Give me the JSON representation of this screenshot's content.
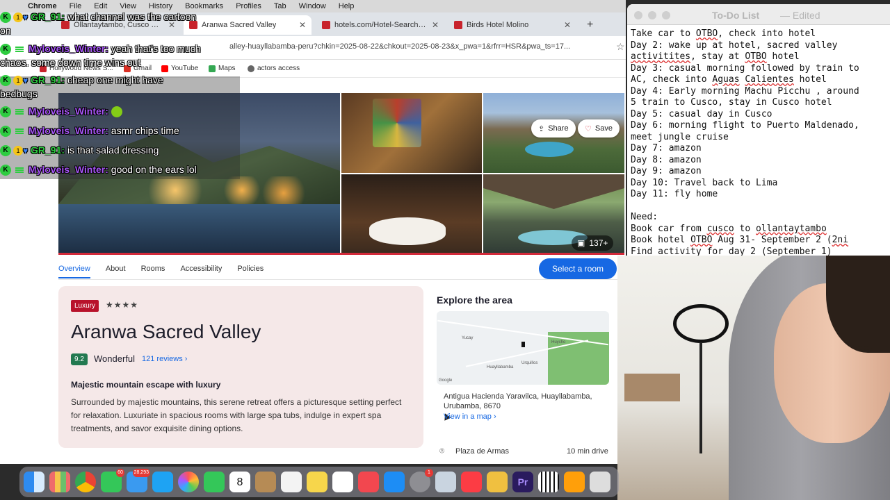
{
  "menubar": {
    "apple": "",
    "items": [
      "Chrome",
      "File",
      "Edit",
      "View",
      "History",
      "Bookmarks",
      "Profiles",
      "Tab",
      "Window",
      "Help"
    ]
  },
  "tabs": [
    {
      "label": "Ollantaytambo, Cusco Regio",
      "active": false
    },
    {
      "label": "Aranwa Sacred Valley",
      "active": true
    },
    {
      "label": "hotels.com/Hotel-Search?de",
      "active": false
    },
    {
      "label": "Birds Hotel Molino",
      "active": false
    }
  ],
  "new_tab": "+",
  "url": "alley-huayllabamba-peru?chkin=2025-08-22&chkout=2025-08-23&x_pwa=1&rfrr=HSR&pwa_ts=17...",
  "bookmarks": [
    {
      "label": "Hollywood News S...",
      "color": "#c8232c"
    },
    {
      "label": "Gmail",
      "color": "#d93025"
    },
    {
      "label": "YouTube",
      "color": "#ff0000"
    },
    {
      "label": "Maps",
      "color": "#34a853"
    },
    {
      "label": "actors access",
      "color": "#666666"
    }
  ],
  "hero": {
    "share_label": "Share",
    "save_label": "Save",
    "photo_count": "137+"
  },
  "subnav": {
    "tabs": [
      "Overview",
      "About",
      "Rooms",
      "Accessibility",
      "Policies"
    ],
    "cta": "Select a room"
  },
  "hotel": {
    "badge": "Luxury",
    "stars": "★★★★",
    "name": "Aranwa Sacred Valley",
    "score": "9.2",
    "score_word": "Wonderful",
    "reviews": "121 reviews",
    "tagline": "Majestic mountain escape with luxury",
    "description": "Surrounded by majestic mountains, this serene retreat offers a picturesque setting perfect for relaxation. Luxuriate in spacious rooms with large spa tubs, indulge in expert spa treatments, and savor exquisite dining options."
  },
  "explore": {
    "title": "Explore the area",
    "address": "Antigua Hacienda Yaravilca, Huayllabamba, Urubamba, 8670",
    "map_link": "View in a map",
    "poi_name": "Plaza de Armas",
    "poi_distance": "10 min drive",
    "map_labels": [
      "Yucay",
      "Huayllabamba",
      "Huycho",
      "Urquillos",
      "Google"
    ]
  },
  "chat": [
    {
      "user": "GR_91:",
      "text": "what channel was the cartoon",
      "style": "green"
    },
    {
      "cont": "on"
    },
    {
      "user": "Myloveis_Winter:",
      "text": "yeah that's too much",
      "style": "purple"
    },
    {
      "cont": "chaos. some down time wins out"
    },
    {
      "user": "GR_91:",
      "text": "cheap one might have",
      "style": "green"
    },
    {
      "cont": "bedbugs"
    },
    {
      "user": "Myloveis_Winter:",
      "text": "",
      "style": "purple"
    },
    {
      "user": "Myloveis_Winter:",
      "text": "asmr chips time",
      "style": "purple"
    },
    {
      "user": "GR_91:",
      "text": "is that salad dressing",
      "style": "green"
    },
    {
      "user": "Myloveis_Winter:",
      "text": "good on the ears lol",
      "style": "purple"
    }
  ],
  "todo": {
    "title": "To-Do List",
    "status": "— Edited",
    "lines": [
      "Take car to OTBO, check into hotel",
      "Day 2: wake up at hotel, sacred valley",
      "activitites, stay at OTBO hotel",
      "Day 3: casual morning followed by train to",
      "AC, check into Aguas Calientes hotel",
      "Day 4: Early morning Machu Picchu , around",
      "5 train to Cusco, stay in Cusco hotel",
      "Day 5: casual day in Cusco",
      "Day 6: morning flight to Puerto Maldenado,",
      "meet jungle cruise",
      "Day 7: amazon",
      "Day 8: amazon",
      "Day 9: amazon",
      "Day 10: Travel back to Lima",
      "Day 11: fly home",
      "",
      "Need:",
      "Book car from cusco to ollantaytambo",
      "Book hotel OTBO Aug 31- September 2 (2ni",
      "Find activity for day 2 (September 1)"
    ]
  },
  "dock": {
    "calendar_day": "8",
    "badges": {
      "messages": "60",
      "mail": "28,293",
      "settings": "1"
    },
    "apps": [
      "finder",
      "launchpad",
      "chrome",
      "messages",
      "mail",
      "appstore-alt",
      "photos",
      "facetime",
      "calendar",
      "contacts",
      "reminders",
      "notes",
      "freeform",
      "news",
      "appstore",
      "system-settings",
      "preview",
      "music",
      "pineapple",
      "premiere",
      "piano",
      "pages",
      "misc"
    ]
  },
  "colors": {
    "accent": "#1668e3",
    "luxury": "#b8122b",
    "score": "#227950",
    "brand_red": "#d32a3a"
  }
}
